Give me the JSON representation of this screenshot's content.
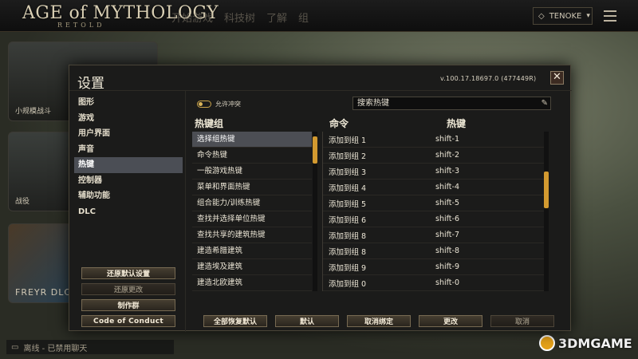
{
  "app": {
    "logo": "AGE of MYTHOLOGY",
    "logo_sub": "RETOLD",
    "nav": [
      "开始游戏",
      "科技树",
      "了解",
      "组"
    ],
    "user_name": "TENOKE"
  },
  "background_tiles": {
    "tile1_label": "小规模战斗",
    "tile2_label": "战役",
    "tile3_label": "FREYR DLC"
  },
  "status_bar": {
    "text": "离线 - 已禁用聊天"
  },
  "watermark": {
    "text": "3DMGAME"
  },
  "dialog": {
    "title": "设置",
    "version": "v.100.17.18697.0 (477449R)",
    "close_label": "✕",
    "categories": [
      {
        "label": "图形",
        "active": false
      },
      {
        "label": "游戏",
        "active": false
      },
      {
        "label": "用户界面",
        "active": false
      },
      {
        "label": "声音",
        "active": false
      },
      {
        "label": "热键",
        "active": true
      },
      {
        "label": "控制器",
        "active": false
      },
      {
        "label": "辅助功能",
        "active": false
      },
      {
        "label": "DLC",
        "active": false
      }
    ],
    "side_buttons": {
      "restore_defaults": "还原默认设置",
      "revert_changes": "还原更改",
      "credits": "制作群",
      "code_of_conduct": "Code of Conduct"
    },
    "toggle": {
      "label": "允许冲突",
      "on": true
    },
    "search": {
      "placeholder": "搜索热键"
    },
    "headers": {
      "groups": "热键组",
      "command": "命令",
      "hotkey": "热键"
    },
    "hotkey_groups": [
      {
        "label": "选择组热键",
        "selected": true
      },
      {
        "label": "命令热键",
        "selected": false
      },
      {
        "label": "一般游戏热键",
        "selected": false
      },
      {
        "label": "菜单和界面热键",
        "selected": false
      },
      {
        "label": "组合能力/训练热键",
        "selected": false
      },
      {
        "label": "查找并选择单位热键",
        "selected": false
      },
      {
        "label": "查找共享的建筑热键",
        "selected": false
      },
      {
        "label": "建造希腊建筑",
        "selected": false
      },
      {
        "label": "建造埃及建筑",
        "selected": false
      },
      {
        "label": "建造北欧建筑",
        "selected": false
      }
    ],
    "commands": [
      {
        "command": "添加到组 1",
        "hotkey": "shift-1"
      },
      {
        "command": "添加到组 2",
        "hotkey": "shift-2"
      },
      {
        "command": "添加到组 3",
        "hotkey": "shift-3"
      },
      {
        "command": "添加到组 4",
        "hotkey": "shift-4"
      },
      {
        "command": "添加到组 5",
        "hotkey": "shift-5"
      },
      {
        "command": "添加到组 6",
        "hotkey": "shift-6"
      },
      {
        "command": "添加到组 8",
        "hotkey": "shift-7"
      },
      {
        "command": "添加到组 8",
        "hotkey": "shift-8"
      },
      {
        "command": "添加到组 9",
        "hotkey": "shift-9"
      },
      {
        "command": "添加到组 0",
        "hotkey": "shift-0"
      }
    ],
    "bottom_buttons": {
      "restore_all": "全部恢复默认",
      "default": "默认",
      "unbind": "取消绑定",
      "change": "更改",
      "cancel": "取消"
    }
  },
  "colors": {
    "accent": "#d39a30",
    "selected_row": "#4c4e54",
    "dialog_bg": "#1b1b1a"
  }
}
